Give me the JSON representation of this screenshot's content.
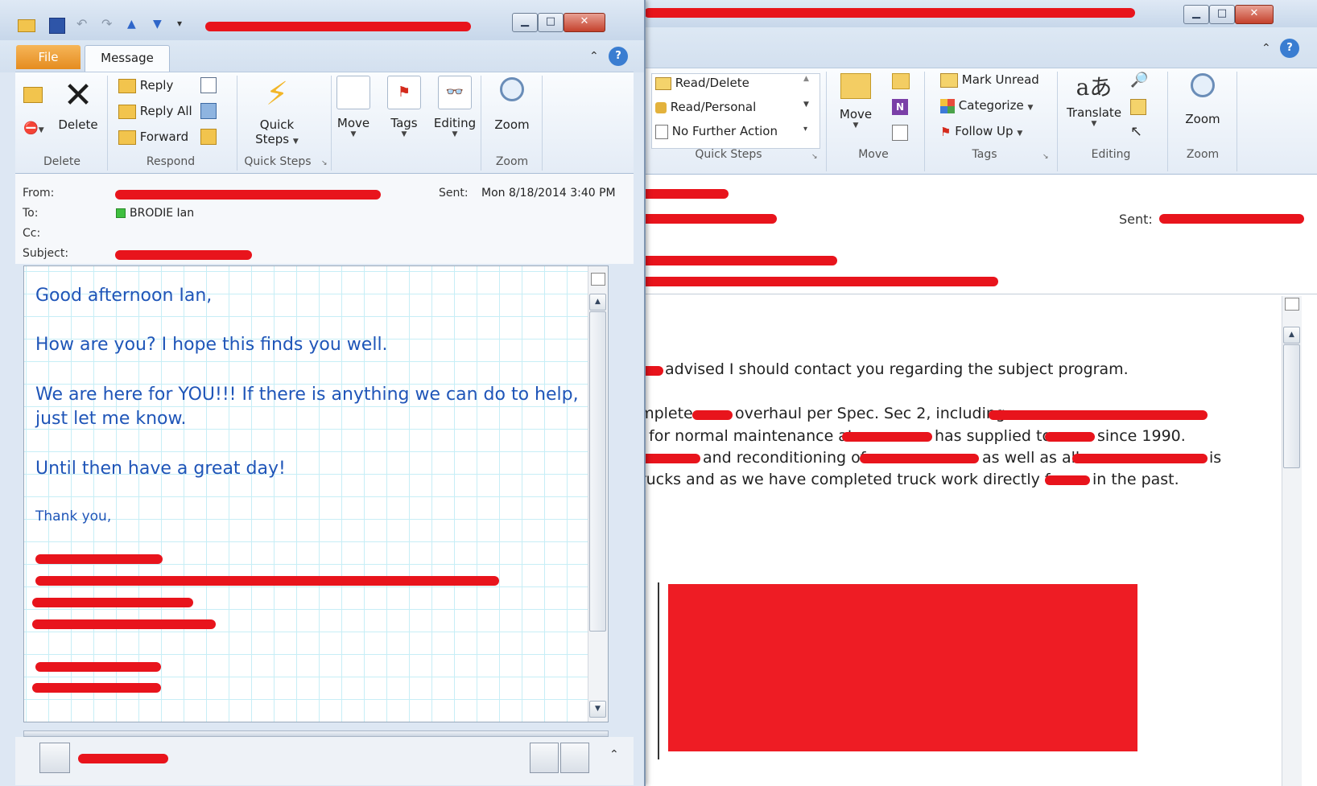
{
  "left_window": {
    "tabs": {
      "file": "File",
      "message": "Message"
    },
    "ribbon": {
      "delete_group": {
        "delete_label": "Delete",
        "group_label": "Delete"
      },
      "respond_group": {
        "reply": "Reply",
        "reply_all": "Reply All",
        "forward": "Forward",
        "group_label": "Respond"
      },
      "quick_steps_group": {
        "line1": "Quick",
        "line2": "Steps",
        "group_label": "Quick Steps"
      },
      "move_label": "Move",
      "tags_label": "Tags",
      "editing_label": "Editing",
      "zoom_label": "Zoom",
      "zoom_group_label": "Zoom"
    },
    "header": {
      "from_label": "From:",
      "to_label": "To:",
      "cc_label": "Cc:",
      "subject_label": "Subject:",
      "sent_label": "Sent:",
      "sent_value": "Mon 8/18/2014 3:40 PM",
      "to_value": "BRODIE Ian"
    },
    "body": {
      "greeting": "Good afternoon Ian,",
      "line1": "How are you? I hope this finds you well.",
      "line2a": "We are here for YOU!!! If there is anything we can do to help,",
      "line2b": "just let me know.",
      "line3": "Until then have a great day!",
      "thanks": "Thank you,"
    }
  },
  "right_window": {
    "ribbon": {
      "quick_steps": {
        "read_delete": "Read/Delete",
        "read_personal": "Read/Personal",
        "no_further_action": "No Further Action",
        "group_label": "Quick Steps"
      },
      "move": {
        "move_label": "Move",
        "group_label": "Move"
      },
      "tags": {
        "mark_unread": "Mark Unread",
        "categorize": "Categorize",
        "follow_up": "Follow Up",
        "group_label": "Tags"
      },
      "editing": {
        "translate": "Translate",
        "group_label": "Editing"
      },
      "zoom": {
        "zoom_label": "Zoom",
        "group_label": "Zoom"
      }
    },
    "header": {
      "sent_label": "Sent:"
    },
    "body": {
      "p1": "advised I should contact you regarding the subject program.",
      "l1a": "complete",
      "l1b": "overhaul per Spec. Sec 2, including",
      "l2a": "for normal maintenance at",
      "l2b": "has supplied to",
      "l2c": "since 1990.",
      "l3a": "and reconditioning of",
      "l3b": "as well as all",
      "l3c": "is",
      "l4a": "Trucks and as we have completed truck work directly for",
      "l4b": "in the past."
    }
  },
  "colors": {
    "body_text_blue": "#1f55b8",
    "redaction_red": "#e8141c",
    "file_tab_orange": "#f0a23a"
  }
}
